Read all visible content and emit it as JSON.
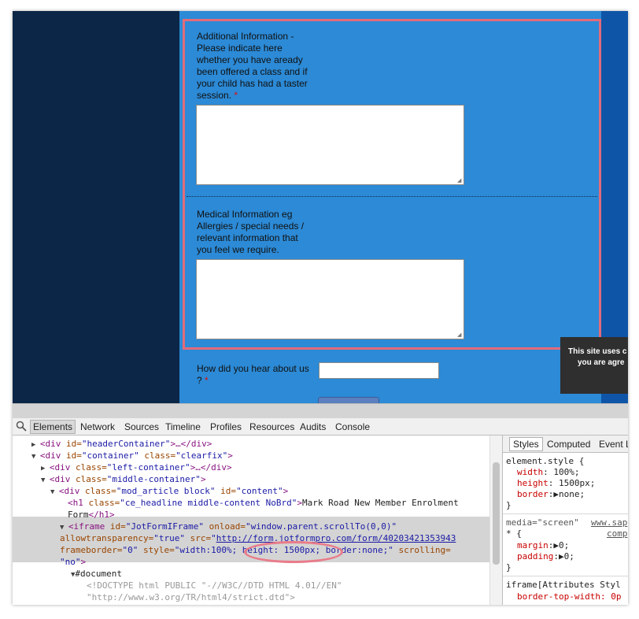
{
  "form": {
    "q1_label_lines": [
      "Additional Information -",
      "Please indicate here",
      "whether you have aready",
      "been offered a class and if",
      "your child has had a taster",
      "session. "
    ],
    "q2_label_lines": [
      "Medical Information eg",
      "Allergies / special needs /",
      "relevant information that",
      "you feel we require."
    ],
    "q3_label_line1": "How did you hear about us",
    "q3_label_line2": "? ",
    "required_mark": "*"
  },
  "cookie": {
    "line1": "This site uses c",
    "line2": "you are agre"
  },
  "devtools": {
    "tabs": [
      "Elements",
      "Network",
      "Sources",
      "Timeline",
      "Profiles",
      "Resources",
      "Audits",
      "Console"
    ],
    "active_tab": "Elements",
    "styles_tabs": [
      "Styles",
      "Computed",
      "Event L"
    ],
    "dom": {
      "l1_tag": "<div ",
      "l1_attr": "id=",
      "l1_val": "\"headerContainer\"",
      "l1_rest": ">…</div>",
      "l2_tag": "<div ",
      "l2_attr1": "id=",
      "l2_val1": "\"container\"",
      "l2_attr2": " class=",
      "l2_val2": "\"clearfix\"",
      "l2_end": ">",
      "l3_tag": "<div ",
      "l3_attr": "class=",
      "l3_val": "\"left-container\"",
      "l3_rest": ">…</div>",
      "l4_tag": "<div ",
      "l4_attr": "class=",
      "l4_val": "\"middle-container\"",
      "l4_end": ">",
      "l5_tag": "<div ",
      "l5_attr1": "class=",
      "l5_val1": "\"mod_article block\"",
      "l5_attr2": " id=",
      "l5_val2": "\"content\"",
      "l5_end": ">",
      "l6_tag": "<h1 ",
      "l6_attr": "class=",
      "l6_val": "\"ce_headline middle-content NoBrd\"",
      "l6_end": ">",
      "l6_text": "Mark Road New Member Enrolment",
      "l7_text": "Form",
      "l7_end": "</h1>",
      "l8_tag": "<iframe ",
      "l8_attr1": "id=",
      "l8_val1": "\"JotFormIFrame\"",
      "l8_attr2": " onload=",
      "l8_val2": "\"window.parent.scrollTo(0,0)\"",
      "l9_attr1": "allowtransparency=",
      "l9_val1": "\"true\"",
      "l9_attr2": " src=",
      "l9_link": "http://form.jotformpro.com/form/40203421353943",
      "l10_attr1": "frameborder=",
      "l10_val1": "\"0\"",
      "l10_attr2": " style=",
      "l10_val2": "\"width:100%; height: 1500px; border:none;\"",
      "l10_attr3": " scrolling=",
      "l11_val": "\"no\"",
      "l11_end": ">",
      "l12_text": "#document",
      "l13_text": "<!DOCTYPE html PUBLIC \"-//W3C//DTD HTML 4.01//EN\"",
      "l14_text": "\"http://www.w3.org/TR/html4/strict.dtd\">"
    },
    "styles": {
      "element_style": "element.style {",
      "width": "width",
      "width_val": ": 100%;",
      "height": "height",
      "height_val": ": 1500px;",
      "border": "border",
      "border_val": ":▶none;",
      "close": "}",
      "media": "media=\"screen\"",
      "media_src": "www.sap",
      "star": "* {",
      "star_src": "comp",
      "margin": "margin",
      "margin_val": ":▶0;",
      "padding": "padding",
      "padding_val": ":▶0;",
      "iframe_attr": "iframe[Attributes Styl",
      "border_top": "border-top-width: 0p"
    }
  },
  "colors": {
    "form_bg": "#2c8ad6",
    "left_bg": "#0c2647",
    "right_bg": "#0f55a7",
    "highlight": "#e36b7a"
  }
}
